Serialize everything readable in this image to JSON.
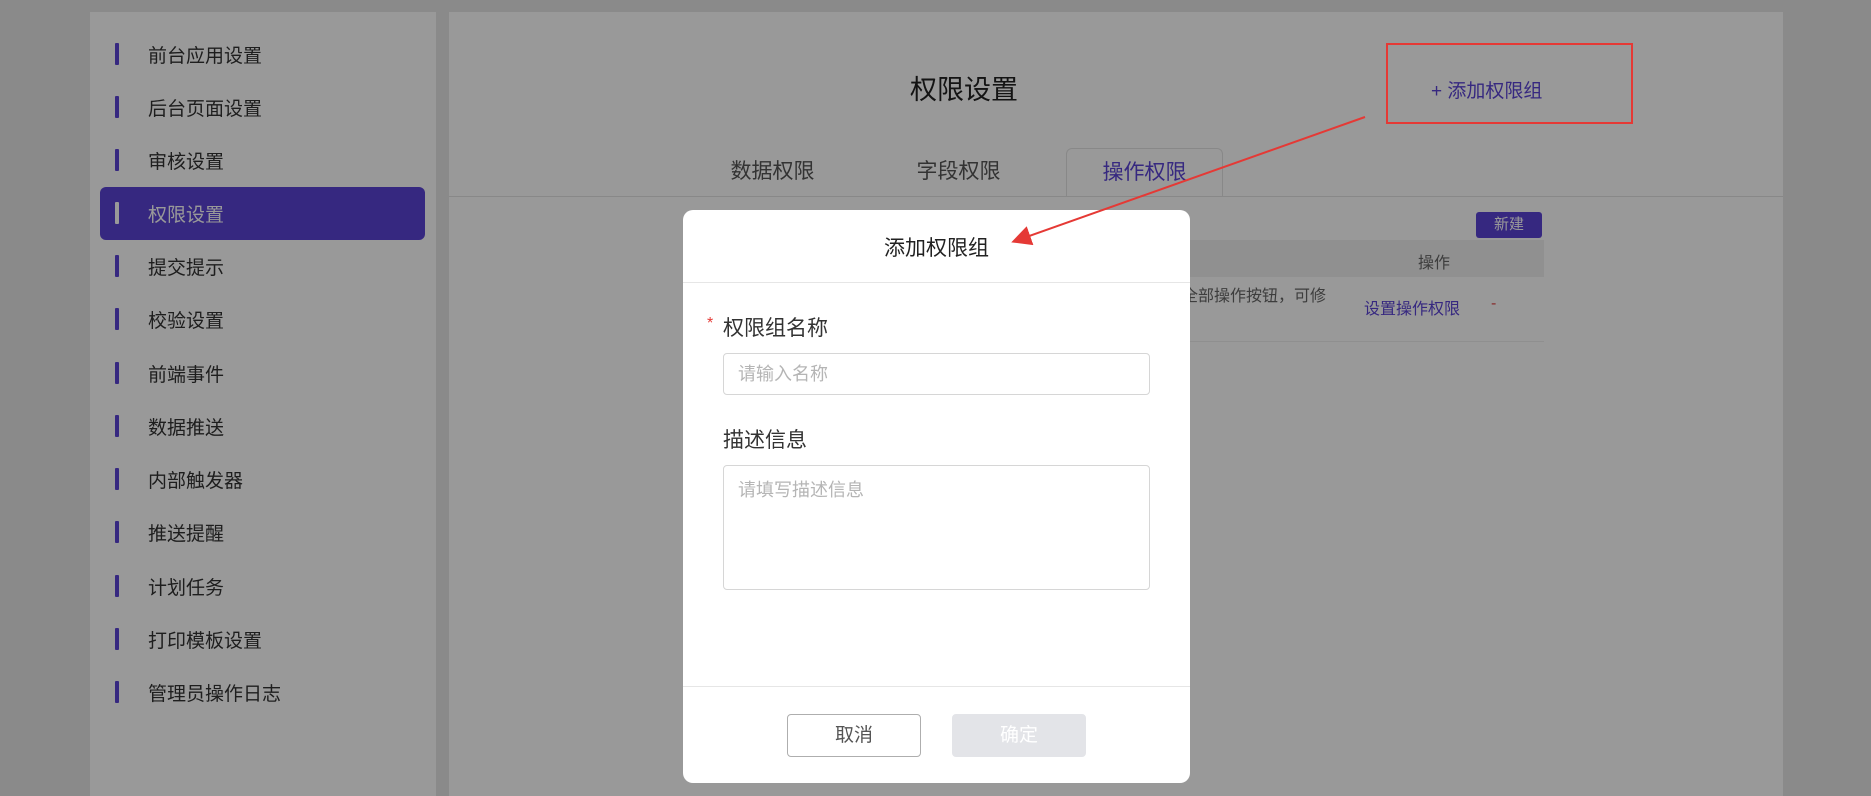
{
  "sidebar": {
    "items": [
      {
        "label": "前台应用设置"
      },
      {
        "label": "后台页面设置"
      },
      {
        "label": "审核设置"
      },
      {
        "label": "权限设置",
        "active": true
      },
      {
        "label": "提交提示"
      },
      {
        "label": "校验设置"
      },
      {
        "label": "前端事件"
      },
      {
        "label": "数据推送"
      },
      {
        "label": "内部触发器"
      },
      {
        "label": "推送提醒"
      },
      {
        "label": "计划任务"
      },
      {
        "label": "打印模板设置"
      },
      {
        "label": "管理员操作日志"
      }
    ]
  },
  "main": {
    "title": "权限设置",
    "add_group_label": "+ 添加权限组",
    "tabs": [
      {
        "label": "数据权限"
      },
      {
        "label": "字段权限"
      },
      {
        "label": "操作权限",
        "active": true
      }
    ],
    "new_button": "新建",
    "table": {
      "header_operation": "操作",
      "row": {
        "description_fragment": "全部操作按钮，可修",
        "set_link": "设置操作权限",
        "delete": "-"
      }
    }
  },
  "modal": {
    "title": "添加权限组",
    "name_label": "权限组名称",
    "required_mark": "*",
    "name_placeholder": "请输入名称",
    "desc_label": "描述信息",
    "desc_placeholder": "请填写描述信息",
    "cancel_label": "取消",
    "ok_label": "确定"
  },
  "colors": {
    "accent": "#5b43d6",
    "annotation": "#e53935"
  }
}
